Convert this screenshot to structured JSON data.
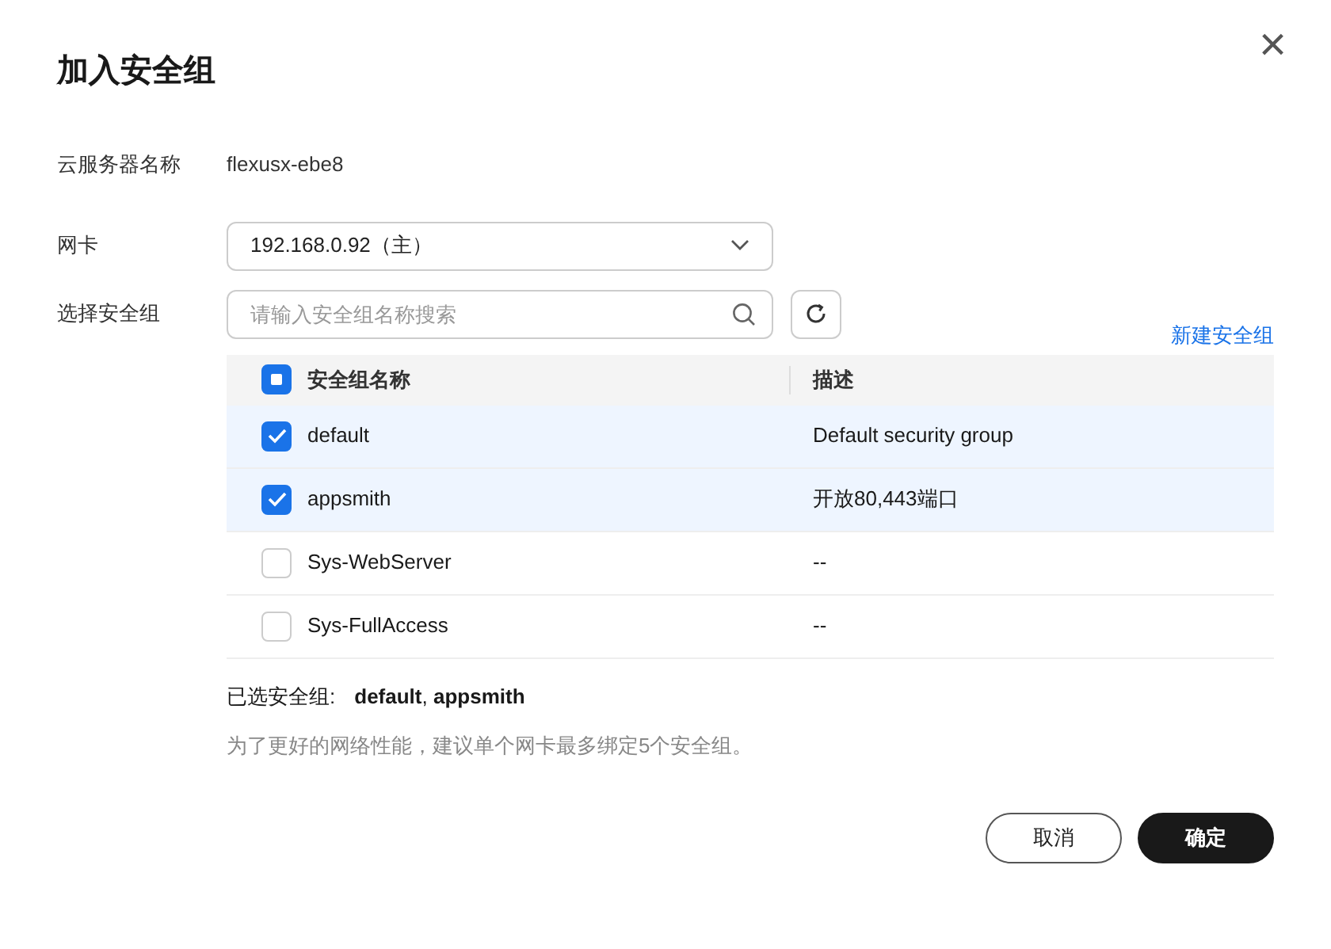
{
  "dialog": {
    "title": "加入安全组",
    "close": "×"
  },
  "server": {
    "label": "云服务器名称",
    "value": "flexusx-ebe8"
  },
  "nic": {
    "label": "网卡",
    "value": "192.168.0.92（主）"
  },
  "security_group": {
    "label": "选择安全组",
    "placeholder": "请输入安全组名称搜索",
    "create_link": "新建安全组"
  },
  "table": {
    "select_all": {
      "indeterminate": true
    },
    "columns": [
      "安全组名称",
      "描述"
    ],
    "rows": [
      {
        "name": "default",
        "description": "Default security group",
        "selected": true
      },
      {
        "name": "appsmith",
        "description": "开放80,443端口",
        "selected": true
      },
      {
        "name": "Sys-WebServer",
        "description": "--",
        "selected": false
      },
      {
        "name": "Sys-FullAccess",
        "description": "--",
        "selected": false
      }
    ]
  },
  "selected_summary": {
    "label": "已选安全组:",
    "value": "**default**, **appsmith**"
  },
  "hint": "为了更好的网络性能，建议单个网卡最多绑定5个安全组。",
  "buttons": [
    {
      "label": "取消",
      "kind": "secondary"
    },
    {
      "label": "确定",
      "kind": "primary"
    }
  ]
}
